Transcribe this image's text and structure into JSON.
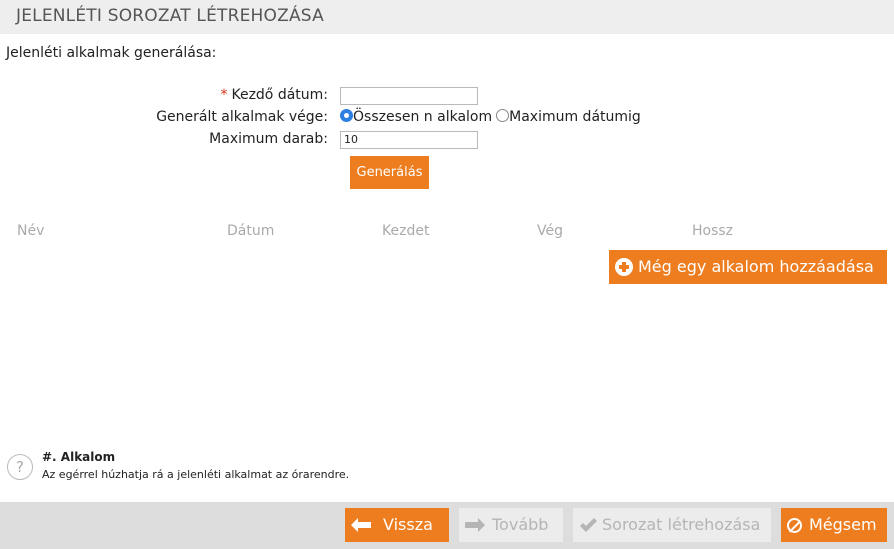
{
  "header": {
    "title": "JELENLÉTI SOROZAT LÉTREHOZÁSA"
  },
  "section_label": "Jelenléti alkalmak generálása:",
  "form": {
    "start_date": {
      "required_mark": "*",
      "label": "Kezdő dátum:",
      "value": ""
    },
    "end_mode": {
      "label": "Generált alkalmak vége:",
      "options": [
        {
          "label": "Összesen n alkalom",
          "checked": true
        },
        {
          "label": "Maximum dátumig",
          "checked": false
        }
      ]
    },
    "max_count": {
      "label": "Maximum darab:",
      "value": "10"
    },
    "generate_label": "Generálás"
  },
  "table": {
    "columns": [
      "Név",
      "Dátum",
      "Kezdet",
      "Vég",
      "Hossz"
    ]
  },
  "add_occurrence_label": "Még egy alkalom hozzáadása",
  "help": {
    "icon": "question-icon",
    "title": "#. Alkalom",
    "text": "Az egérrel húzhatja rá a jelenléti alkalmat az órarendre."
  },
  "footer": {
    "back_label": "Vissza",
    "next_label": "Tovább",
    "create_label": "Sorozat létrehozása",
    "cancel_label": "Mégsem"
  },
  "colors": {
    "accent": "#ed7d1f",
    "radio_selected": "#2f7fe2",
    "required": "#d9331a",
    "disabled_text": "#b5b5b5"
  }
}
